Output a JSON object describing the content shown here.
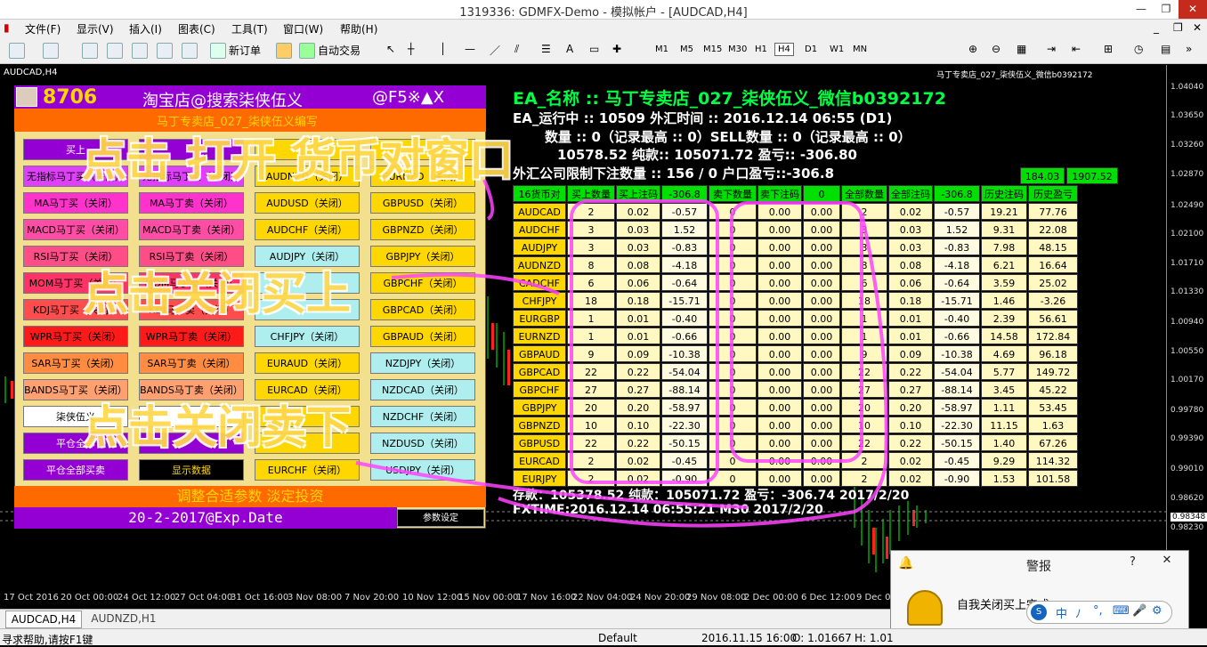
{
  "window": {
    "title": "1319336: GDMFX-Demo - 模拟帐户 - [AUDCAD,H4]"
  },
  "menu": [
    "文件(F)",
    "显示(V)",
    "插入(I)",
    "图表(C)",
    "工具(T)",
    "窗口(W)",
    "帮助(H)"
  ],
  "toolbar": {
    "new_order": "新订单",
    "auto_trade": "自动交易",
    "timeframes": [
      "M1",
      "M5",
      "M15",
      "M30",
      "H1",
      "H4",
      "D1",
      "W1",
      "MN"
    ],
    "active_timeframe": "H4"
  },
  "chart": {
    "symbol_title": "AUDCAD,H4",
    "ea_title_right": "马丁专卖店_027_柒侠伍义_微信b0392172",
    "prices": [
      "1.04040",
      "1.03650",
      "1.03260",
      "1.02870",
      "1.02490",
      "1.02100",
      "1.01710",
      "1.01330",
      "1.00940",
      "1.00550",
      "1.00170",
      "0.99780",
      "0.99390",
      "0.99010",
      "0.98620",
      "0.98348",
      "0.98230"
    ],
    "current_price": "0.98348",
    "time_labels": [
      "17 Oct 2016",
      "20 Oct 00:00",
      "24 Oct 12:00",
      "27 Oct 04:00",
      "31 Oct 16:00",
      "3 Nov 08:00",
      "7 Nov 20:00",
      "10 Nov 12:00",
      "15 Nov 00:00",
      "17 Nov 16:00",
      "22 Nov 04:00",
      "24 Nov 20:00",
      "29 Nov 08:00",
      "2 Dec 00:00",
      "6 Dec 12:00",
      "9 Dec 04:00"
    ]
  },
  "panel": {
    "number": "8706",
    "shop": "淘宝店@搜索柒侠伍义",
    "controls": "@F5※▲X",
    "subheader": "马丁专卖店_027_柒侠伍义编写",
    "bottom_slogan": "调整合适参数 淡定投资",
    "expiry": "20-2-2017@Exp.Date",
    "param_button": "参数设定",
    "col1": [
      {
        "label": "买上",
        "color": "#9400d3",
        "text": "#fff"
      },
      {
        "label": "无指标马丁买（关闭）",
        "color": "#e040fb",
        "text": "#000"
      },
      {
        "label": "MA马丁买（关闭）",
        "color": "#ff33cc",
        "text": "#000"
      },
      {
        "label": "MACD马丁买（关闭）",
        "color": "#ff4da6",
        "text": "#000"
      },
      {
        "label": "RSI马丁买（关闭）",
        "color": "#ff4d88",
        "text": "#000"
      },
      {
        "label": "MOM马丁买（关闭）",
        "color": "#ff3366",
        "text": "#000"
      },
      {
        "label": "KDJ马丁买（关闭）",
        "color": "#ff4d4d",
        "text": "#000"
      },
      {
        "label": "WPR马丁买（关闭）",
        "color": "#ff1a1a",
        "text": "#000"
      },
      {
        "label": "SAR马丁买（关闭）",
        "color": "#ff8c40",
        "text": "#000"
      },
      {
        "label": "BANDS马丁买（关闭）",
        "color": "#ffa070",
        "text": "#000"
      },
      {
        "label": "柒侠伍义",
        "color": "#ffffff",
        "text": "#000"
      },
      {
        "label": "平仓全部",
        "color": "#9400d3",
        "text": "#fff"
      },
      {
        "label": "平仓全部买卖",
        "color": "#9400d3",
        "text": "#fff"
      }
    ],
    "col2": [
      {
        "label": "",
        "color": "#9400d3",
        "text": "#fff"
      },
      {
        "label": "无指标马丁卖（关闭）",
        "color": "#e040fb",
        "text": "#000"
      },
      {
        "label": "MA马丁卖（关闭）",
        "color": "#ff33cc",
        "text": "#000"
      },
      {
        "label": "MACD马丁卖（关闭）",
        "color": "#ff4da6",
        "text": "#000"
      },
      {
        "label": "RSI马丁卖（关闭）",
        "color": "#ff4d88",
        "text": "#000"
      },
      {
        "label": "MOM马丁卖（关闭）",
        "color": "#ff3366",
        "text": "#000"
      },
      {
        "label": "KDJ马丁卖（关闭）",
        "color": "#ff4d4d",
        "text": "#000"
      },
      {
        "label": "WPR马丁卖（关闭）",
        "color": "#ff1a1a",
        "text": "#000"
      },
      {
        "label": "SAR马丁卖（关闭）",
        "color": "#ff8c40",
        "text": "#000"
      },
      {
        "label": "BANDS马丁卖（关闭）",
        "color": "#ffa070",
        "text": "#000"
      },
      {
        "label": "",
        "color": "#ffffff",
        "text": "#000"
      },
      {
        "label": "",
        "color": "#9400d3",
        "text": "#fff"
      },
      {
        "label": "显示数据",
        "color": "#000000",
        "text": "#ffd700"
      }
    ],
    "col3": [
      {
        "label": "",
        "color": "#ffd700"
      },
      {
        "label": "AUDNZD（关闭）",
        "color": "#ffd700"
      },
      {
        "label": "AUDUSD（关闭）",
        "color": "#ffd700"
      },
      {
        "label": "AUDCHF（关闭）",
        "color": "#ffd700"
      },
      {
        "label": "AUDJPY（关闭）",
        "color": "#aeeeee"
      },
      {
        "label": "",
        "color": "#aeeeee"
      },
      {
        "label": "",
        "color": "#aeeeee"
      },
      {
        "label": "CHFJPY（关闭）",
        "color": "#aeeeee"
      },
      {
        "label": "EURAUD（关闭）",
        "color": "#ffd700"
      },
      {
        "label": "EURCAD（关闭）",
        "color": "#ffd700"
      },
      {
        "label": "",
        "color": "#ffd700"
      },
      {
        "label": "",
        "color": "#ffd700"
      },
      {
        "label": "EURCHF（关闭）",
        "color": "#ffd700"
      }
    ],
    "col4": [
      {
        "label": "",
        "color": "#ffd700"
      },
      {
        "label": "EURNZD（关闭）",
        "color": "#ffd700"
      },
      {
        "label": "GBPUSD（关闭）",
        "color": "#ffd700"
      },
      {
        "label": "GBPNZD（关闭）",
        "color": "#ffd700"
      },
      {
        "label": "GBPJPY（关闭）",
        "color": "#ffd700"
      },
      {
        "label": "GBPCHF（关闭）",
        "color": "#ffd700"
      },
      {
        "label": "GBPCAD（关闭）",
        "color": "#ffd700"
      },
      {
        "label": "GBPAUD（关闭）",
        "color": "#ffd700"
      },
      {
        "label": "NZDJPY（关闭）",
        "color": "#aeeeee"
      },
      {
        "label": "NZDCAD（关闭）",
        "color": "#aeeeee"
      },
      {
        "label": "NZDCHF（关闭）",
        "color": "#aeeeee"
      },
      {
        "label": "NZDUSD（关闭）",
        "color": "#aeeeee"
      },
      {
        "label": "USDJPY（关闭）",
        "color": "#aeeeee"
      }
    ]
  },
  "ea": {
    "name_line": "EA_名称 :: 马丁专卖店_027_柒侠伍义_微信b0392172",
    "running_line": "EA_运行中 :: 10509 外汇时间 :: 2016.12.14 06:55 (D1)",
    "count_line": "数量 :: 0（记录最高 :: 0）SELL数量 :: 0（记录最高 :: 0）",
    "balance_line": "10578.52  纯款:: 105071.72  盈亏:: -306.80",
    "limit_line": "外汇公司限制下注数量 :: 156 / 0 户口盈亏::-306.8",
    "footer_deposit": "存款：105378.52  纯款：105071.72  盈亏：-306.74  2017/2/20",
    "footer_time": "FXTIME:2016.12.14 06:55:21 M30 2017/2/20",
    "history_totals": [
      "184.03",
      "1907.52"
    ]
  },
  "table": {
    "headers": [
      "16货币对",
      "买上数量",
      "买上注码",
      "-306.8",
      "卖下数量",
      "卖下注码",
      "0",
      "全部数量",
      "全部注码",
      "-306.8",
      "历史注码",
      "历史盈亏"
    ],
    "rows": [
      [
        "AUDCAD",
        "2",
        "0.02",
        "-0.57",
        "0",
        "0.00",
        "0.00",
        "2",
        "0.02",
        "-0.57",
        "19.21",
        "77.76"
      ],
      [
        "AUDCHF",
        "3",
        "0.03",
        "1.52",
        "0",
        "0.00",
        "0.00",
        "3",
        "0.03",
        "1.52",
        "9.31",
        "22.08"
      ],
      [
        "AUDJPY",
        "3",
        "0.03",
        "-0.83",
        "0",
        "0.00",
        "0.00",
        "3",
        "0.03",
        "-0.83",
        "7.98",
        "48.15"
      ],
      [
        "AUDNZD",
        "8",
        "0.08",
        "-4.18",
        "0",
        "0.00",
        "0.00",
        "8",
        "0.08",
        "-4.18",
        "6.21",
        "16.64"
      ],
      [
        "CADCHF",
        "6",
        "0.06",
        "-0.64",
        "0",
        "0.00",
        "0.00",
        "6",
        "0.06",
        "-0.64",
        "3.59",
        "25.02"
      ],
      [
        "CHFJPY",
        "18",
        "0.18",
        "-15.71",
        "0",
        "0.00",
        "0.00",
        "18",
        "0.18",
        "-15.71",
        "1.46",
        "-3.26"
      ],
      [
        "EURGBP",
        "1",
        "0.01",
        "-0.40",
        "0",
        "0.00",
        "0.00",
        "1",
        "0.01",
        "-0.40",
        "2.39",
        "56.61"
      ],
      [
        "EURNZD",
        "1",
        "0.01",
        "-0.66",
        "0",
        "0.00",
        "0.00",
        "1",
        "0.01",
        "-0.66",
        "14.58",
        "172.84"
      ],
      [
        "GBPAUD",
        "9",
        "0.09",
        "-10.38",
        "0",
        "0.00",
        "0.00",
        "9",
        "0.09",
        "-10.38",
        "4.69",
        "96.18"
      ],
      [
        "GBPCAD",
        "22",
        "0.22",
        "-54.04",
        "0",
        "0.00",
        "0.00",
        "22",
        "0.22",
        "-54.04",
        "5.77",
        "149.72"
      ],
      [
        "GBPCHF",
        "27",
        "0.27",
        "-88.14",
        "0",
        "0.00",
        "0.00",
        "27",
        "0.27",
        "-88.14",
        "3.45",
        "45.22"
      ],
      [
        "GBPJPY",
        "20",
        "0.20",
        "-58.97",
        "0",
        "0.00",
        "0.00",
        "20",
        "0.20",
        "-58.97",
        "1.11",
        "53.45"
      ],
      [
        "GBPNZD",
        "10",
        "0.10",
        "-22.30",
        "0",
        "0.00",
        "0.00",
        "10",
        "0.10",
        "-22.30",
        "11.15",
        "1.63"
      ],
      [
        "GBPUSD",
        "22",
        "0.22",
        "-50.15",
        "0",
        "0.00",
        "0.00",
        "22",
        "0.22",
        "-50.15",
        "1.40",
        "67.26"
      ],
      [
        "EURCAD",
        "2",
        "0.02",
        "-0.45",
        "0",
        "0.00",
        "0.00",
        "2",
        "0.02",
        "-0.45",
        "9.29",
        "114.32"
      ],
      [
        "EURJPY",
        "2",
        "0.02",
        "-0.90",
        "0",
        "0.00",
        "0.00",
        "2",
        "0.02",
        "-0.90",
        "1.53",
        "101.58"
      ]
    ]
  },
  "overlays": {
    "open_pair": "点击 打开 货币对窗口",
    "close_buy": "点击关闭买上",
    "close_sell": "点击关闭卖下"
  },
  "alert": {
    "title": "警报",
    "help": "?",
    "message": "自我关闭买上完成"
  },
  "ime": [
    "中",
    "ﾉ",
    "°,",
    "⌨",
    "🎤",
    "⚙"
  ],
  "tabs": [
    "AUDCAD,H4",
    "AUDNZD,H1"
  ],
  "status": {
    "help": "寻求帮助,请按F1键",
    "profile": "Default",
    "datetime": "2016.11.15 16:00",
    "open": "O: 1.01667",
    "high": "H: 1.01"
  }
}
